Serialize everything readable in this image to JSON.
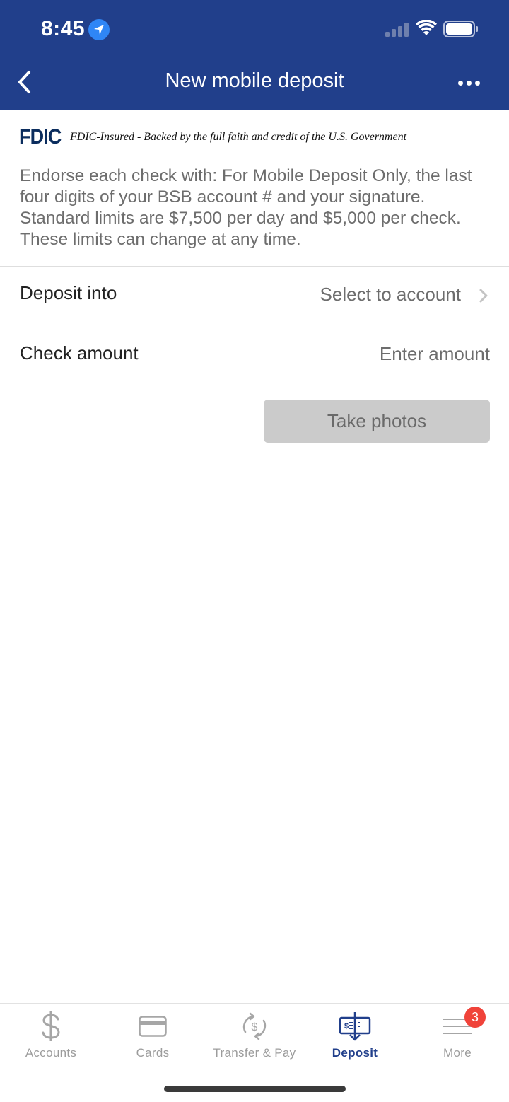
{
  "status_bar": {
    "time": "8:45"
  },
  "nav": {
    "title": "New mobile deposit"
  },
  "fdic": {
    "logo": "FDIC",
    "text": "FDIC-Insured - Backed by the full faith and credit of the U.S. Government"
  },
  "disclaimer": "Endorse each check with: For Mobile Deposit Only, the last four digits of your BSB account # and your signature. Standard limits are $7,500 per day and $5,000 per check. These limits can change at any time.",
  "form": {
    "deposit_into_label": "Deposit into",
    "deposit_into_value": "Select to account",
    "check_amount_label": "Check amount",
    "check_amount_placeholder": "Enter amount",
    "check_amount_value": ""
  },
  "actions": {
    "take_photos_label": "Take photos"
  },
  "tabs": [
    {
      "label": "Accounts",
      "icon": "dollar-icon",
      "active": false
    },
    {
      "label": "Cards",
      "icon": "card-icon",
      "active": false
    },
    {
      "label": "Transfer & Pay",
      "icon": "transfer-icon",
      "active": false
    },
    {
      "label": "Deposit",
      "icon": "check-deposit-icon",
      "active": true
    },
    {
      "label": "More",
      "icon": "menu-icon",
      "active": false,
      "badge": "3"
    }
  ],
  "colors": {
    "header_bg": "#213f8b",
    "active_tab": "#213f8b",
    "badge": "#f0433a",
    "disabled_button": "#cbcbcb"
  }
}
